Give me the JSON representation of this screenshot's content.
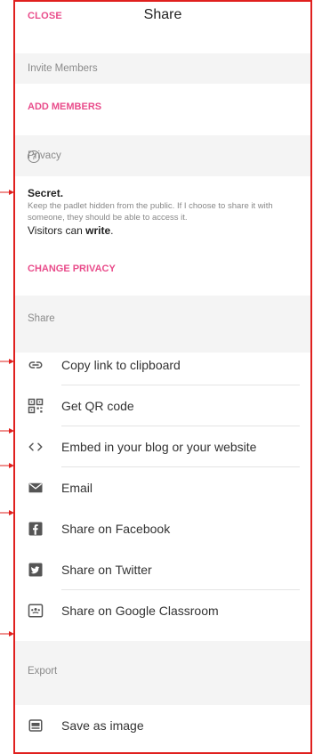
{
  "header": {
    "close_label": "CLOSE",
    "title": "Share"
  },
  "invite": {
    "section_label": "Invite Members",
    "add_members": "ADD MEMBERS"
  },
  "privacy": {
    "section_label": "Privacy",
    "help_icon": "question-mark",
    "mode_title": "Secret.",
    "mode_description": "Keep the padlet hidden from the public. If I choose to share it with someone, they should be able to access it.",
    "visitors_prefix": "Visitors can",
    "visitors_permission": "write",
    "visitors_suffix": ".",
    "change_label": "CHANGE PRIVACY"
  },
  "share": {
    "section_label": "Share",
    "items": [
      {
        "label": "Copy link to clipboard",
        "icon": "link-icon"
      },
      {
        "label": "Get QR code",
        "icon": "qr-code-icon"
      },
      {
        "label": "Embed in your blog or your website",
        "icon": "code-icon"
      },
      {
        "label": "Email",
        "icon": "envelope-icon"
      },
      {
        "label": "Share on Facebook",
        "icon": "facebook-icon"
      },
      {
        "label": "Share on Twitter",
        "icon": "twitter-icon"
      },
      {
        "label": "Share on Google Classroom",
        "icon": "google-classroom-icon"
      }
    ]
  },
  "export": {
    "section_label": "Export",
    "items": [
      {
        "label": "Save as image",
        "icon": "image-save-icon"
      }
    ]
  },
  "colors": {
    "accent": "#e94c8b",
    "annotation": "#e0201e",
    "section_bg": "#f4f4f4"
  }
}
